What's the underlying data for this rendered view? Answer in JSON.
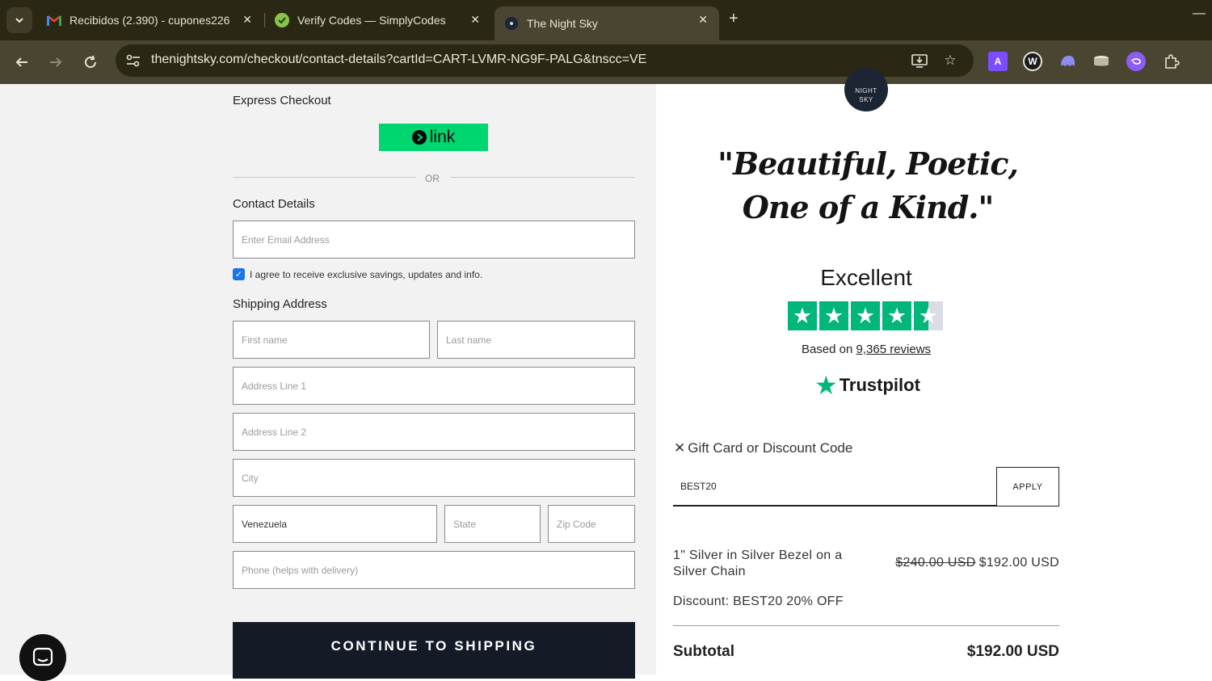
{
  "browser": {
    "tabs": [
      {
        "title": "Recibidos (2.390) - cupones226",
        "favicon": "gmail-icon"
      },
      {
        "title": "Verify Codes — SimplyCodes",
        "favicon": "simplycodes-icon"
      },
      {
        "title": "The Night Sky",
        "favicon": "nightsky-icon",
        "active": true
      }
    ],
    "url": "thenightsky.com/checkout/contact-details?cartId=CART-LVMR-NG9F-PALG&tnscc=VE"
  },
  "checkout": {
    "express_label": "Express Checkout",
    "link_label": "link",
    "or_label": "OR",
    "contact_label": "Contact Details",
    "email_placeholder": "Enter Email Address",
    "agree_label": "I agree to receive exclusive savings, updates and info.",
    "agree_checked": true,
    "shipping_label": "Shipping Address",
    "first_name_placeholder": "First name",
    "last_name_placeholder": "Last name",
    "address1_placeholder": "Address Line 1",
    "address2_placeholder": "Address Line 2",
    "city_placeholder": "City",
    "country_value": "Venezuela",
    "state_placeholder": "State",
    "zip_placeholder": "Zip Code",
    "phone_placeholder": "Phone (helps with delivery)",
    "continue_label": "CONTINUE TO SHIPPING"
  },
  "summary": {
    "logo_line1": "NIGHT",
    "logo_line2": "SKY",
    "quote_line1": "\"Beautiful, Poetic,",
    "quote_line2": "One of a Kind.\"",
    "rating_word": "Excellent",
    "rating_stars": 4.5,
    "based_prefix": "Based on ",
    "reviews_link": "9,365 reviews",
    "trustpilot_name": "Trustpilot",
    "gift_label": "Gift Card or Discount Code",
    "code_value": "BEST20",
    "apply_label": "APPLY",
    "item_name": "1\" Silver in Silver Bezel on a Silver Chain",
    "item_old_price": "$240.00 USD",
    "item_price": "$192.00 USD",
    "discount_text": "Discount: BEST20 20% OFF",
    "subtotal_label": "Subtotal",
    "subtotal_value": "$192.00 USD"
  },
  "colors": {
    "link_green": "#00d66f",
    "trustpilot_green": "#00b67a",
    "button_dark": "#141b27"
  }
}
